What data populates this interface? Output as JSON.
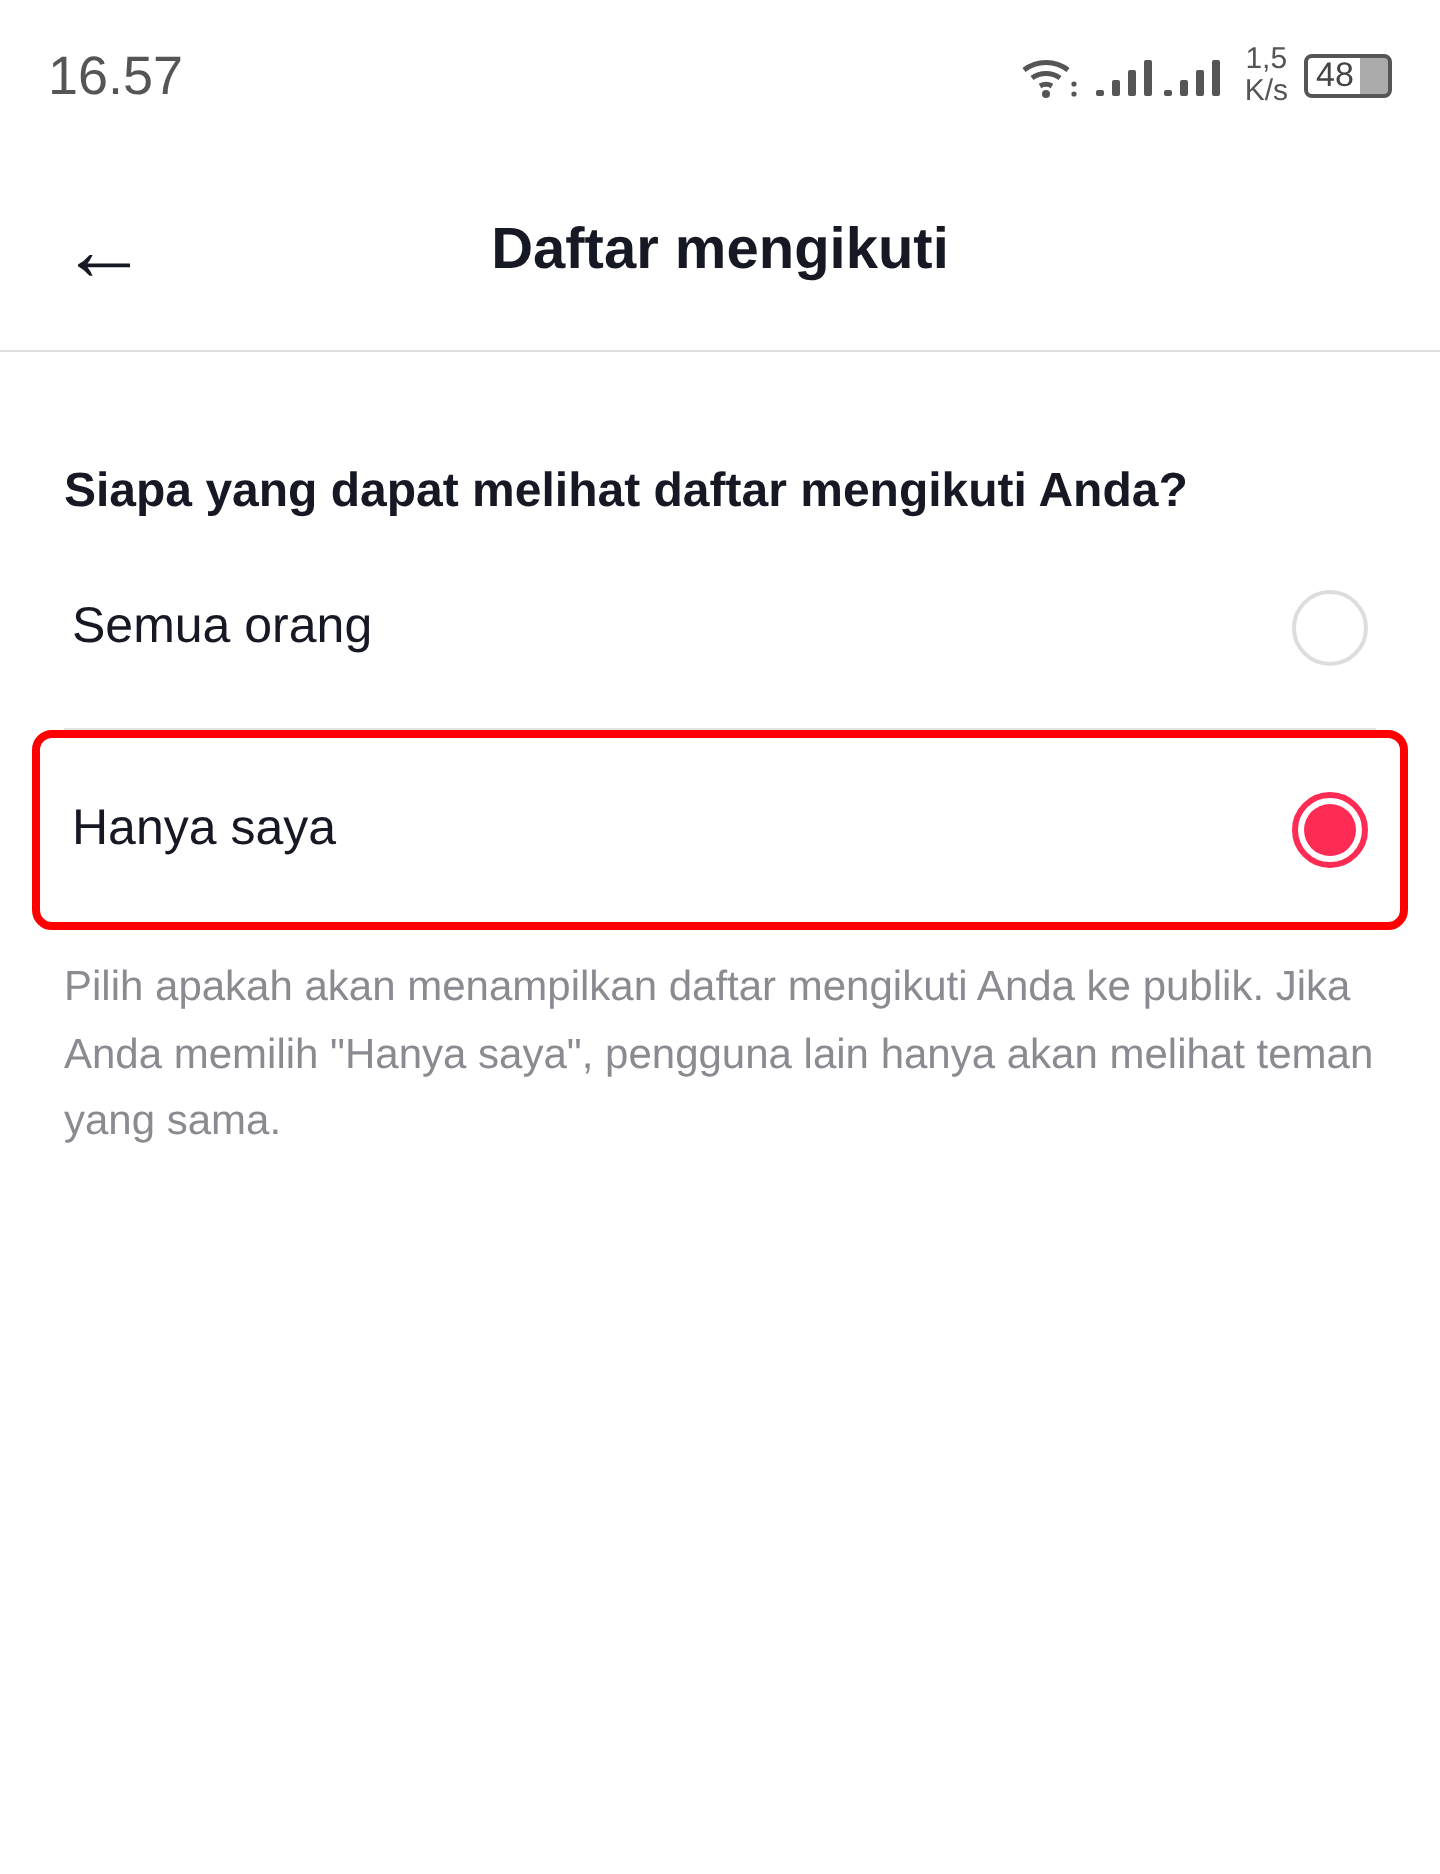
{
  "status_bar": {
    "time": "16.57",
    "speed_value": "1,5",
    "speed_unit": "K/s",
    "battery": "48"
  },
  "header": {
    "back": "←",
    "title": "Daftar mengikuti"
  },
  "question": "Siapa yang dapat melihat daftar mengikuti Anda?",
  "options": [
    {
      "label": "Semua orang",
      "selected": false,
      "highlighted": false
    },
    {
      "label": "Hanya saya",
      "selected": true,
      "highlighted": true
    }
  ],
  "description": "Pilih apakah akan menampilkan daftar mengikuti Anda ke publik. Jika Anda memilih \"Hanya saya\", pengguna lain hanya akan melihat teman yang sama."
}
